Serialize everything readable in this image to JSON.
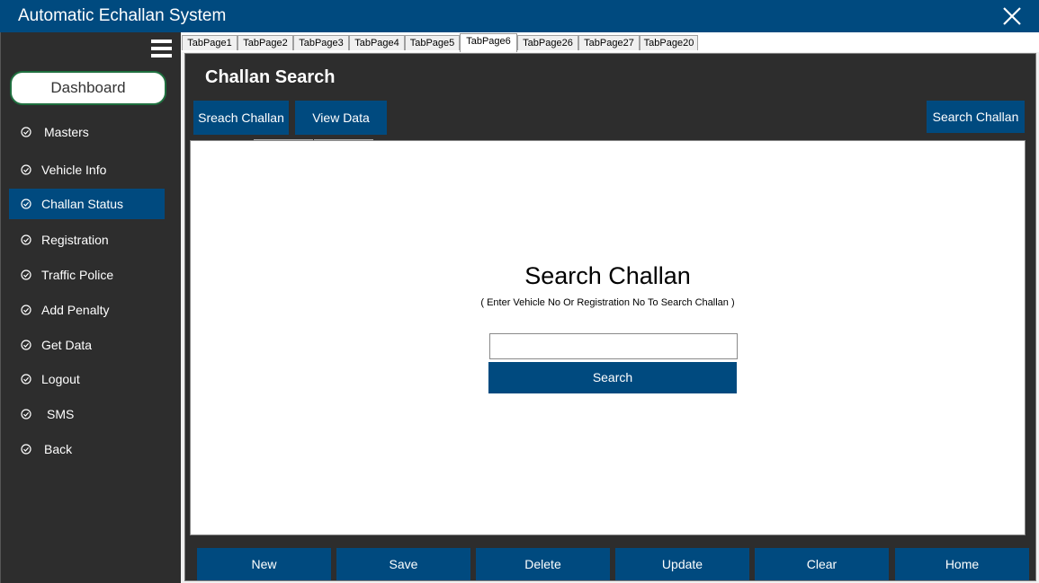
{
  "app": {
    "title": "Automatic Echallan System"
  },
  "sidebar": {
    "dashboard_label": "Dashboard",
    "items": [
      {
        "label": "Masters"
      },
      {
        "label": "Vehicle Info"
      },
      {
        "label": "Challan Status"
      },
      {
        "label": "Registration"
      },
      {
        "label": "Traffic Police"
      },
      {
        "label": "Add Penalty"
      },
      {
        "label": "Get Data"
      },
      {
        "label": "Logout"
      },
      {
        "label": "SMS"
      },
      {
        "label": "Back"
      }
    ],
    "active_item": "Challan Status"
  },
  "tabs": [
    {
      "label": "TabPage1"
    },
    {
      "label": "TabPage2"
    },
    {
      "label": "TabPage3"
    },
    {
      "label": "TabPage4"
    },
    {
      "label": "TabPage5"
    },
    {
      "label": "TabPage6"
    },
    {
      "label": "TabPage26"
    },
    {
      "label": "TabPage27"
    },
    {
      "label": "TabPage20"
    }
  ],
  "active_tab": "TabPage6",
  "panel": {
    "title": "Challan Search",
    "left_buttons": [
      "Sreach Challan",
      "View Data"
    ],
    "right_button": "Search Challan"
  },
  "search": {
    "heading": "Search Challan",
    "hint": "( Enter Vehicle No Or Registration No To Search Challan )",
    "input_value": "",
    "button_label": "Search"
  },
  "bottom_buttons": [
    "New",
    "Save",
    "Delete",
    "Update",
    "Clear",
    "Home"
  ],
  "colors": {
    "primary": "#004a7f",
    "sidebar_bg": "#2d2d2d",
    "dashboard_border": "#1f6f3f"
  },
  "icons": {
    "close": "close-icon",
    "menu": "hamburger-menu-icon",
    "menu_item": "check-circle-icon"
  }
}
